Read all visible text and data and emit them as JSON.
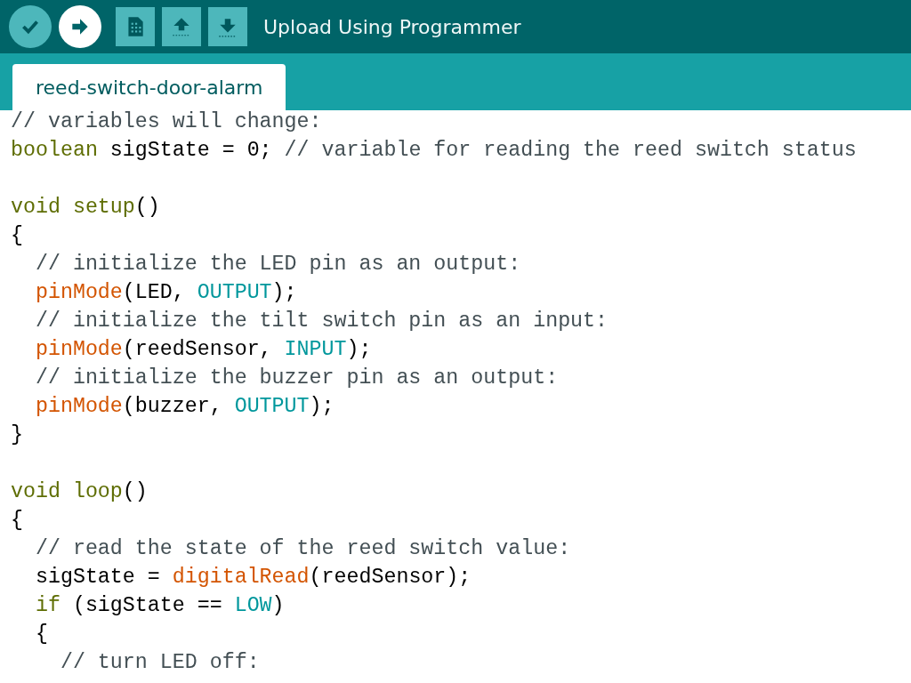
{
  "toolbar": {
    "buttons": [
      {
        "kind": "verify",
        "hovered": false
      },
      {
        "kind": "upload",
        "hovered": true
      },
      {
        "kind": "new",
        "hovered": false
      },
      {
        "kind": "open",
        "hovered": false
      },
      {
        "kind": "save",
        "hovered": false
      }
    ],
    "hint": "Upload Using Programmer"
  },
  "tabs": [
    {
      "label": "reed-switch-door-alarm",
      "selected": true
    }
  ],
  "editor": {
    "lines": [
      {
        "tokens": [
          {
            "kind": "comment",
            "text": "// variables will change:"
          }
        ]
      },
      {
        "tokens": [
          {
            "kind": "keyword",
            "text": "boolean"
          },
          {
            "kind": "plain",
            "text": " sigState = 0; "
          },
          {
            "kind": "comment",
            "text": "// variable for reading the reed switch status"
          }
        ]
      },
      {
        "kind": "blank"
      },
      {
        "tokens": [
          {
            "kind": "keyword",
            "text": "void setup"
          },
          {
            "kind": "plain",
            "text": "()"
          }
        ]
      },
      {
        "tokens": [
          {
            "kind": "plain",
            "text": "{"
          }
        ]
      },
      {
        "tokens": [
          {
            "kind": "comment",
            "text": "  // initialize the LED pin as an output:"
          }
        ]
      },
      {
        "tokens": [
          {
            "kind": "function",
            "text": "  pinMode"
          },
          {
            "kind": "plain",
            "text": "(LED, "
          },
          {
            "kind": "constant",
            "text": "OUTPUT"
          },
          {
            "kind": "plain",
            "text": ");"
          }
        ]
      },
      {
        "tokens": [
          {
            "kind": "comment",
            "text": "  // initialize the tilt switch pin as an input:"
          }
        ]
      },
      {
        "tokens": [
          {
            "kind": "function",
            "text": "  pinMode"
          },
          {
            "kind": "plain",
            "text": "(reedSensor, "
          },
          {
            "kind": "constant",
            "text": "INPUT"
          },
          {
            "kind": "plain",
            "text": ");"
          }
        ]
      },
      {
        "tokens": [
          {
            "kind": "comment",
            "text": "  // initialize the buzzer pin as an output:"
          }
        ]
      },
      {
        "tokens": [
          {
            "kind": "function",
            "text": "  pinMode"
          },
          {
            "kind": "plain",
            "text": "(buzzer, "
          },
          {
            "kind": "constant",
            "text": "OUTPUT"
          },
          {
            "kind": "plain",
            "text": ");"
          }
        ]
      },
      {
        "tokens": [
          {
            "kind": "plain",
            "text": "}"
          }
        ]
      },
      {
        "kind": "blank"
      },
      {
        "tokens": [
          {
            "kind": "keyword",
            "text": "void loop"
          },
          {
            "kind": "plain",
            "text": "()"
          }
        ]
      },
      {
        "tokens": [
          {
            "kind": "plain",
            "text": "{"
          }
        ]
      },
      {
        "tokens": [
          {
            "kind": "comment",
            "text": "  // read the state of the reed switch value:"
          }
        ]
      },
      {
        "tokens": [
          {
            "kind": "plain",
            "text": "  sigState = "
          },
          {
            "kind": "function",
            "text": "digitalRead"
          },
          {
            "kind": "plain",
            "text": "(reedSensor);"
          }
        ]
      },
      {
        "tokens": [
          {
            "kind": "keyword",
            "text": "  if"
          },
          {
            "kind": "plain",
            "text": " (sigState == "
          },
          {
            "kind": "constant",
            "text": "LOW"
          },
          {
            "kind": "plain",
            "text": ")"
          }
        ]
      },
      {
        "tokens": [
          {
            "kind": "plain",
            "text": "  {"
          }
        ]
      },
      {
        "tokens": [
          {
            "kind": "comment",
            "text": "    // turn LED off:"
          }
        ]
      }
    ]
  }
}
